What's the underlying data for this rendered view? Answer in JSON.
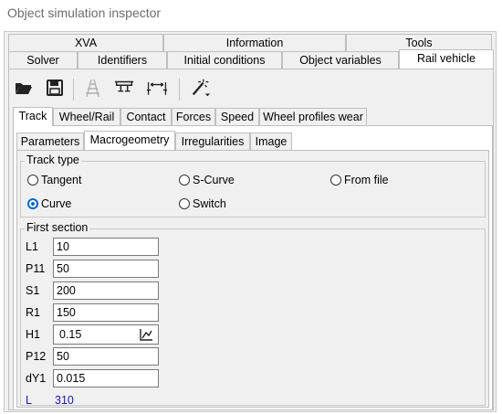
{
  "window": {
    "title": "Object simulation inspector"
  },
  "top_tabs_row1": [
    "XVA",
    "Information",
    "Tools"
  ],
  "top_tabs_row2": [
    "Solver",
    "Identifiers",
    "Initial conditions",
    "Object variables",
    "Rail vehicle"
  ],
  "toolbar": {
    "icons": [
      "open-folder-icon",
      "save-icon",
      "track-icon",
      "rail-profile-icon",
      "wheel-gauge-icon",
      "magic-wand-dropdown-icon"
    ]
  },
  "subtabs": [
    "Track",
    "Wheel/Rail",
    "Contact",
    "Forces",
    "Speed",
    "Wheel profiles wear"
  ],
  "subsubtabs": [
    "Parameters",
    "Macrogeometry",
    "Irregularities",
    "Image"
  ],
  "track_type": {
    "legend": "Track type",
    "options": [
      "Tangent",
      "S-Curve",
      "From file",
      "Curve",
      "Switch"
    ],
    "selected": "Curve"
  },
  "first_section": {
    "legend": "First section",
    "fields": [
      {
        "label": "L1",
        "value": "10"
      },
      {
        "label": "P11",
        "value": "50"
      },
      {
        "label": "S1",
        "value": "200"
      },
      {
        "label": "R1",
        "value": "150"
      },
      {
        "label": "H1",
        "value": "0.15"
      },
      {
        "label": "P12",
        "value": "50"
      },
      {
        "label": "dY1",
        "value": "0.015"
      }
    ],
    "total_label": "L",
    "total_value": "310",
    "total_color": "#1a1aa6"
  },
  "colors": {
    "accent": "#0067c0"
  }
}
